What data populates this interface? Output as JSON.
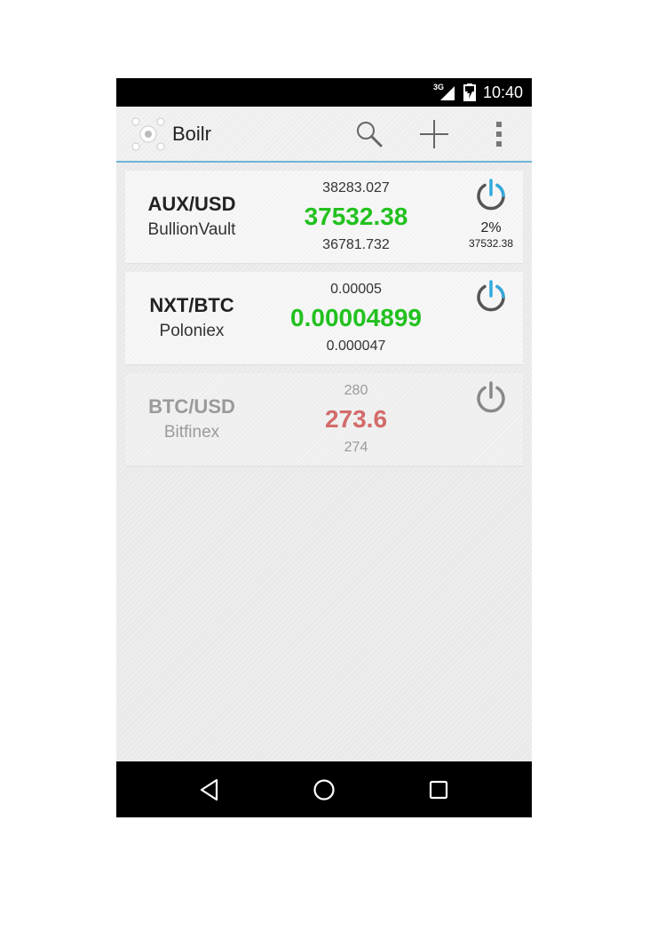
{
  "status_bar": {
    "network": "3G",
    "time": "10:40"
  },
  "action_bar": {
    "app_title": "Boilr",
    "icons": [
      "search-icon",
      "add-icon",
      "overflow-menu-icon"
    ]
  },
  "alarms": [
    {
      "pair": "AUX/USD",
      "exchange": "BullionVault",
      "upper": "38283.027",
      "last": "37532.38",
      "lower": "36781.732",
      "variation_pct": "2%",
      "variation_base": "37532.38",
      "enabled": true,
      "last_color": "#22c11e"
    },
    {
      "pair": "NXT/BTC",
      "exchange": "Poloniex",
      "upper": "0.00005",
      "last": "0.00004899",
      "lower": "0.000047",
      "enabled": true,
      "last_color": "#22c11e"
    },
    {
      "pair": "BTC/USD",
      "exchange": "Bitfinex",
      "upper": "280",
      "last": "273.6",
      "lower": "274",
      "enabled": false,
      "last_color": "#d36b6b"
    }
  ],
  "nav_bar": {
    "icons": [
      "back-icon",
      "home-icon",
      "recents-icon"
    ]
  },
  "colors": {
    "accent": "#33aadd",
    "up_green": "#22c11e",
    "down_red": "#d36b6b"
  }
}
